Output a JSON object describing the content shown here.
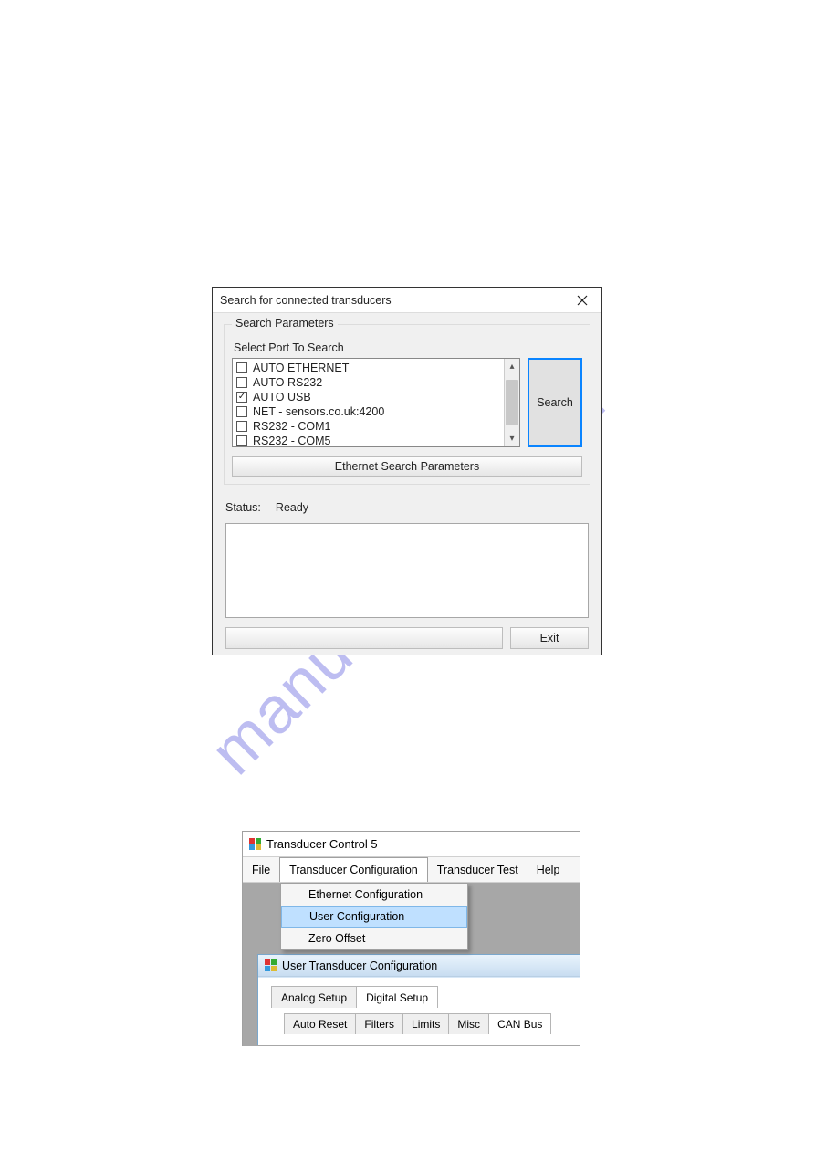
{
  "watermark": "manualshive.com",
  "dialog1": {
    "title": "Search for connected transducers",
    "group_legend": "Search Parameters",
    "select_label": "Select Port To Search",
    "ports": [
      {
        "label": "AUTO ETHERNET",
        "checked": false
      },
      {
        "label": "AUTO RS232",
        "checked": false
      },
      {
        "label": "AUTO USB",
        "checked": true
      },
      {
        "label": "NET - sensors.co.uk:4200",
        "checked": false
      },
      {
        "label": "RS232 - COM1",
        "checked": false
      },
      {
        "label": "RS232 - COM5",
        "checked": false
      }
    ],
    "search_btn": "Search",
    "ethernet_btn": "Ethernet Search Parameters",
    "status_label": "Status:",
    "status_value": "Ready",
    "exit_btn": "Exit"
  },
  "window2": {
    "title": "Transducer Control 5",
    "menu": {
      "file": "File",
      "config": "Transducer Configuration",
      "test": "Transducer Test",
      "help": "Help"
    },
    "dropdown": {
      "ethernet": "Ethernet Configuration",
      "user": "User Configuration",
      "zero": "Zero Offset"
    },
    "child_title": "User Transducer Configuration",
    "tabs": {
      "analog": "Analog Setup",
      "digital": "Digital Setup"
    },
    "subtabs": {
      "autoreset": "Auto Reset",
      "filters": "Filters",
      "limits": "Limits",
      "misc": "Misc",
      "canbus": "CAN Bus"
    }
  }
}
